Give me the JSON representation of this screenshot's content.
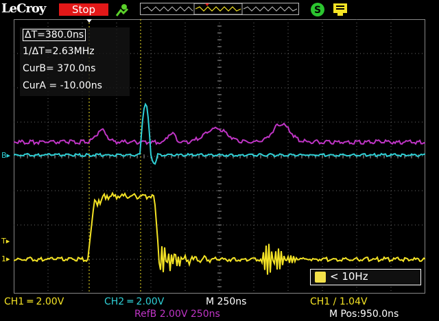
{
  "brand": "LeCroy",
  "run_state": "Stop",
  "readouts": {
    "delta_t": "ΔT=380.0ns",
    "inv_delta_t": "1/ΔT=2.63MHz",
    "cur_b_label": "CurB",
    "cur_b_value": "= 370.0ns",
    "cur_a": "CurA = -10.00ns"
  },
  "markers": {
    "ref_b": "B",
    "ch1_trigger": "T",
    "ch1": "1"
  },
  "frequency": "< 10Hz",
  "bottom": {
    "ch1": "CH1 ═ 2.00V",
    "ch2": "CH2 ═ 2.00V",
    "timebase": "M 250ns",
    "trigger": "CH1 ∕ 1.04V",
    "refb": "RefB 2.00V 250ns",
    "position": "M Pos:950.0ns"
  },
  "colors": {
    "ch1": "#f4e325",
    "ch2": "#2fd0d6",
    "refb": "#c035c6",
    "grid": "#6e6e6e",
    "stop": "#e31818"
  },
  "icons": {
    "acquire": "running-figure-icon",
    "trigger": "trigger-status-icon",
    "usb": "usb-storage-icon"
  }
}
